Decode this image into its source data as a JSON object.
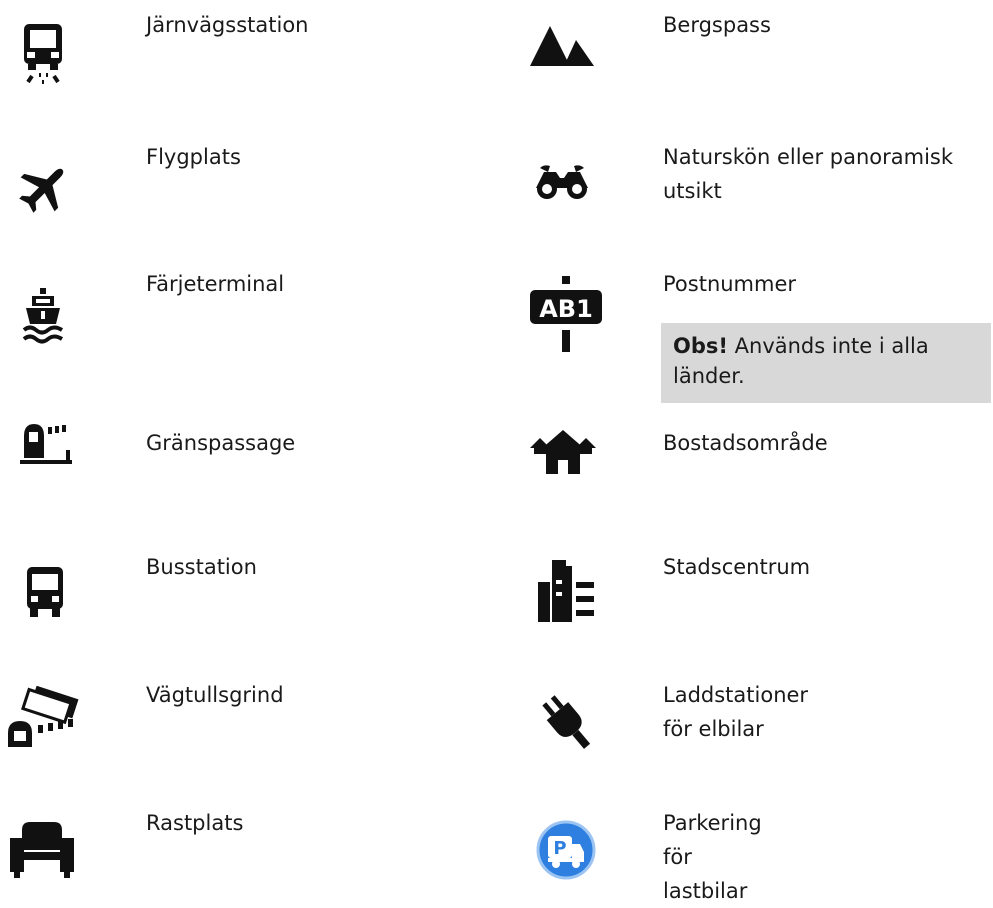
{
  "left_column": [
    {
      "icon": "train-station-icon",
      "label": "Järnvägsstation"
    },
    {
      "icon": "airport-icon",
      "label": "Flygplats"
    },
    {
      "icon": "ferry-terminal-icon",
      "label": "Färjeterminal"
    },
    {
      "icon": "border-crossing-icon",
      "label": "Gränspassage"
    },
    {
      "icon": "bus-station-icon",
      "label": "Busstation"
    },
    {
      "icon": "toll-gate-icon",
      "label": "Vägtullsgrind"
    },
    {
      "icon": "rest-area-icon",
      "label": "Rastplats"
    }
  ],
  "right_column": [
    {
      "icon": "mountain-pass-icon",
      "label": "Bergspass"
    },
    {
      "icon": "scenic-view-icon",
      "label": "Naturskön eller panoramisk utsikt"
    },
    {
      "icon": "postcode-icon",
      "label": "Postnummer",
      "icon_text": "AB1"
    },
    {
      "icon": "residential-area-icon",
      "label": "Bostadsområde"
    },
    {
      "icon": "city-centre-icon",
      "label": "Stadscentrum"
    },
    {
      "icon": "ev-charging-icon",
      "label": "Laddstationer för elbilar"
    },
    {
      "icon": "truck-parking-icon",
      "label": "Parkering för lastbilar",
      "icon_text": "P"
    }
  ],
  "note": {
    "bold": "Obs!",
    "text": " Används inte i alla länder."
  },
  "colors": {
    "icon": "#111111",
    "note_background": "#d8d8d8",
    "truck_parking_blue": "#2f7fe0"
  }
}
